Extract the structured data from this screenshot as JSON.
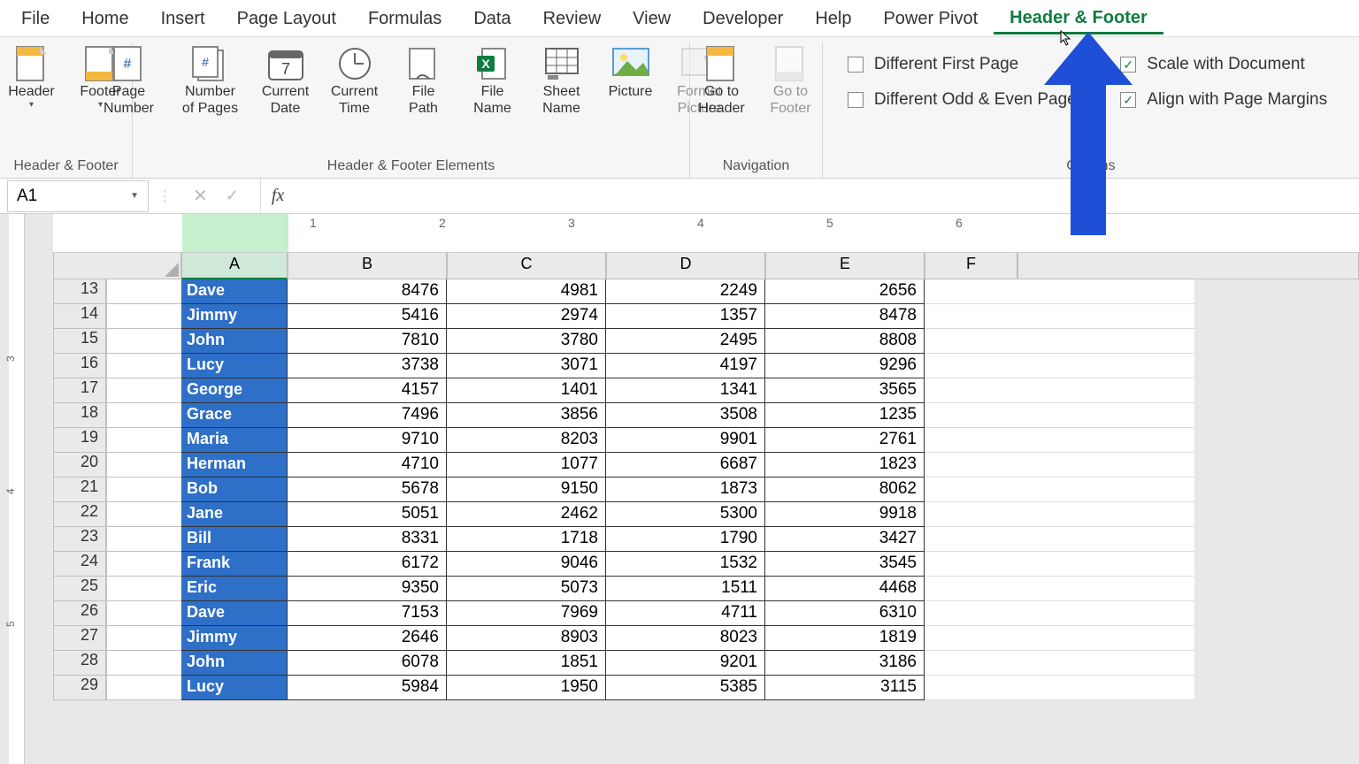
{
  "tabs": [
    "File",
    "Home",
    "Insert",
    "Page Layout",
    "Formulas",
    "Data",
    "Review",
    "View",
    "Developer",
    "Help",
    "Power Pivot",
    "Header & Footer"
  ],
  "active_tab_index": 11,
  "ribbon": {
    "group1": {
      "label": "Header & Footer",
      "header": "Header",
      "footer": "Footer"
    },
    "group2": {
      "label": "Header & Footer Elements",
      "pagenum": "Page\nNumber",
      "numpages": "Number\nof Pages",
      "curdate": "Current\nDate",
      "curtime": "Current\nTime",
      "filepath": "File\nPath",
      "filename": "File\nName",
      "sheetname": "Sheet\nName",
      "picture": "Picture",
      "formatpic": "Format\nPicture"
    },
    "group3": {
      "label": "Navigation",
      "gotoheader": "Go to\nHeader",
      "gotofooter": "Go to\nFooter"
    },
    "group4": {
      "label": "Options",
      "diff_first": "Different First Page",
      "diff_odd_even": "Different Odd & Even Pages",
      "scale_doc": "Scale with Document",
      "align_margins": "Align with Page Margins",
      "scale_checked": true,
      "align_checked": true
    }
  },
  "formula_bar": {
    "name": "A1",
    "fx": "fx",
    "value": ""
  },
  "ruler_ticks": [
    "1",
    "2",
    "3",
    "4",
    "5",
    "6",
    "7"
  ],
  "vertical_ticks": [
    "3",
    "4",
    "5"
  ],
  "columns": [
    "A",
    "B",
    "C",
    "D",
    "E",
    "F"
  ],
  "selected_column_index": 0,
  "first_row_number": 13,
  "rows": [
    {
      "name": "Dave",
      "b": 8476,
      "c": 4981,
      "d": 2249,
      "e": 2656
    },
    {
      "name": "Jimmy",
      "b": 5416,
      "c": 2974,
      "d": 1357,
      "e": 8478
    },
    {
      "name": "John",
      "b": 7810,
      "c": 3780,
      "d": 2495,
      "e": 8808
    },
    {
      "name": "Lucy",
      "b": 3738,
      "c": 3071,
      "d": 4197,
      "e": 9296
    },
    {
      "name": "George",
      "b": 4157,
      "c": 1401,
      "d": 1341,
      "e": 3565
    },
    {
      "name": "Grace",
      "b": 7496,
      "c": 3856,
      "d": 3508,
      "e": 1235
    },
    {
      "name": "Maria",
      "b": 9710,
      "c": 8203,
      "d": 9901,
      "e": 2761
    },
    {
      "name": "Herman",
      "b": 4710,
      "c": 1077,
      "d": 6687,
      "e": 1823
    },
    {
      "name": "Bob",
      "b": 5678,
      "c": 9150,
      "d": 1873,
      "e": 8062
    },
    {
      "name": "Jane",
      "b": 5051,
      "c": 2462,
      "d": 5300,
      "e": 9918
    },
    {
      "name": "Bill",
      "b": 8331,
      "c": 1718,
      "d": 1790,
      "e": 3427
    },
    {
      "name": "Frank",
      "b": 6172,
      "c": 9046,
      "d": 1532,
      "e": 3545
    },
    {
      "name": "Eric",
      "b": 9350,
      "c": 5073,
      "d": 1511,
      "e": 4468
    },
    {
      "name": "Dave",
      "b": 7153,
      "c": 7969,
      "d": 4711,
      "e": 6310
    },
    {
      "name": "Jimmy",
      "b": 2646,
      "c": 8903,
      "d": 8023,
      "e": 1819
    },
    {
      "name": "John",
      "b": 6078,
      "c": 1851,
      "d": 9201,
      "e": 3186
    },
    {
      "name": "Lucy",
      "b": 5984,
      "c": 1950,
      "d": 5385,
      "e": 3115
    }
  ]
}
